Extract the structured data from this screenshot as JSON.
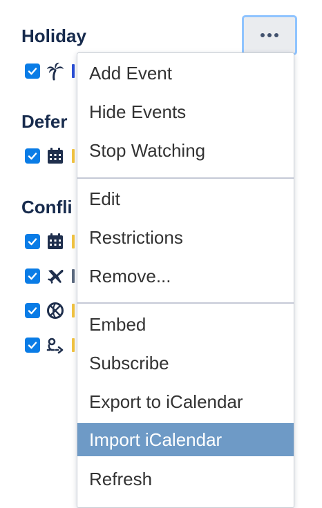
{
  "sections": [
    {
      "title": "Holiday"
    },
    {
      "title": "Defer"
    },
    {
      "title": "Confli"
    }
  ],
  "calendars": [
    {
      "icon": "palm-tree-icon",
      "checked": true,
      "color": "#2b4fd6"
    },
    {
      "icon": "calendar-icon",
      "checked": true,
      "color": "#f4c542"
    },
    {
      "icon": "calendar-icon",
      "checked": true,
      "color": "#f4c542"
    },
    {
      "icon": "airplane-icon",
      "checked": true,
      "color": "#5c6b80"
    },
    {
      "icon": "basketball-icon",
      "checked": true,
      "color": "#f4c542"
    },
    {
      "icon": "travel-route-icon",
      "checked": true,
      "color": "#f4c542"
    }
  ],
  "more_button": {
    "icon": "more-horizontal-icon"
  },
  "menu": {
    "groups": [
      {
        "items": [
          {
            "label": "Add Event"
          },
          {
            "label": "Hide Events"
          },
          {
            "label": "Stop Watching"
          }
        ]
      },
      {
        "items": [
          {
            "label": "Edit"
          },
          {
            "label": "Restrictions"
          },
          {
            "label": "Remove..."
          }
        ]
      },
      {
        "items": [
          {
            "label": "Embed"
          },
          {
            "label": "Subscribe"
          },
          {
            "label": "Export to iCalendar"
          },
          {
            "label": "Import iCalendar",
            "highlighted": true
          },
          {
            "label": "Refresh"
          }
        ]
      }
    ]
  },
  "colors": {
    "heading": "#172b4d",
    "checkbox": "#0a7ce6",
    "menu_highlight": "#6e9ac6",
    "menu_text": "#333333",
    "focus_ring": "#8fc4ff"
  }
}
